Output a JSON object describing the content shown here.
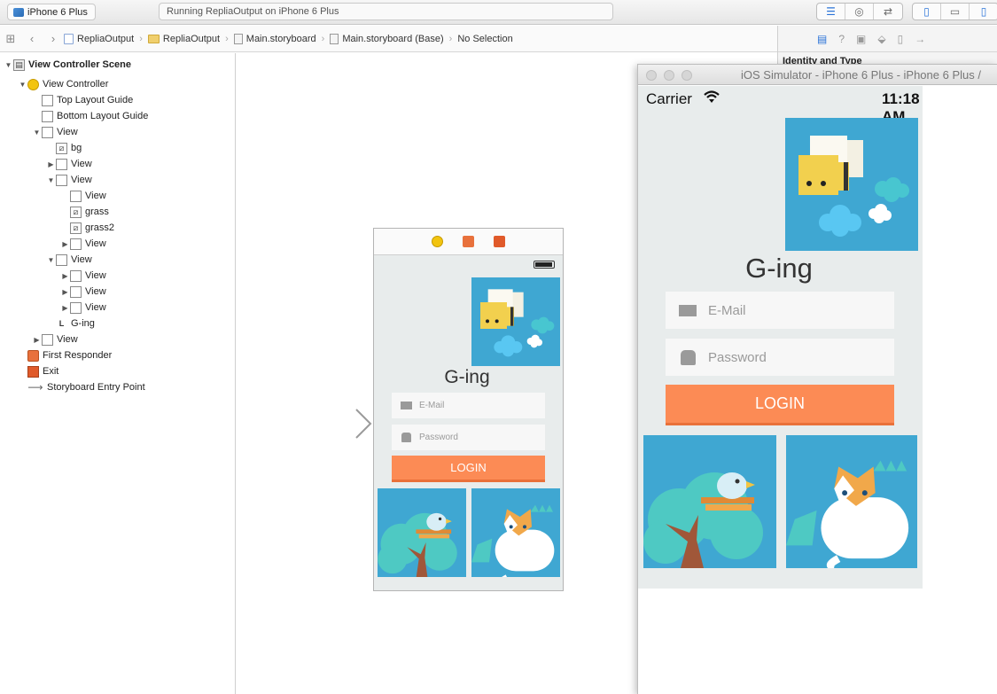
{
  "toolbar": {
    "scheme_device": "iPhone 6 Plus",
    "status_text": "Running RepliaOutput on iPhone 6 Plus"
  },
  "jumpbar": {
    "crumbs": [
      "RepliaOutput",
      "RepliaOutput",
      "Main.storyboard",
      "Main.storyboard (Base)",
      "No Selection"
    ]
  },
  "inspector": {
    "section_title": "Identity and Type"
  },
  "outline": {
    "items": [
      {
        "label": "View Controller Scene"
      },
      {
        "label": "View Controller"
      },
      {
        "label": "Top Layout Guide"
      },
      {
        "label": "Bottom Layout Guide"
      },
      {
        "label": "View"
      },
      {
        "label": "bg"
      },
      {
        "label": "View"
      },
      {
        "label": "View"
      },
      {
        "label": "View"
      },
      {
        "label": "grass"
      },
      {
        "label": "grass2"
      },
      {
        "label": "View"
      },
      {
        "label": "View"
      },
      {
        "label": "View"
      },
      {
        "label": "View"
      },
      {
        "label": "View"
      },
      {
        "label": "G-ing"
      },
      {
        "label": "View"
      },
      {
        "label": "First Responder"
      },
      {
        "label": "Exit"
      },
      {
        "label": "Storyboard Entry Point"
      }
    ]
  },
  "app": {
    "name": "G-ing",
    "email_placeholder": "E-Mail",
    "password_placeholder": "Password",
    "login_label": "LOGIN"
  },
  "simulator": {
    "title": "iOS Simulator - iPhone 6 Plus - iPhone 6 Plus /",
    "carrier": "Carrier",
    "time": "11:18 AM"
  },
  "colors": {
    "art_blue": "#3fa7d2",
    "login_orange": "#fc8b55",
    "screen_bg": "#e8ecec",
    "selected_blue": "#2a73d8"
  }
}
